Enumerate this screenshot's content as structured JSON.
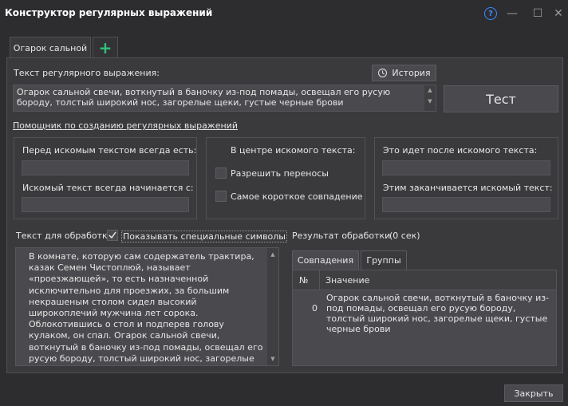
{
  "window": {
    "title": "Конструктор регулярных выражений",
    "help_glyph": "?",
    "min_glyph": "—",
    "max_glyph": "☐",
    "close_glyph": "✕"
  },
  "tabs": {
    "active_label": "Огарок сальной",
    "add_glyph": "+"
  },
  "regex": {
    "label": "Текст регулярного выражения:",
    "history_button": "История",
    "value": "Огарок сальной свечи, воткнутый в баночку из-под помады, освещал его русую бороду, толстый широкий нос, загорелые щеки, густые черные брови",
    "test_button": "Тест"
  },
  "helper": {
    "link": "Помощник по созданию регулярных выражений",
    "left": {
      "before_label": "Перед искомым текстом всегда есть:",
      "begins_label": "Искомый текст всегда начинается с:"
    },
    "center": {
      "title": "В центре искомого текста:",
      "allow_wrap": "Разрешить переносы",
      "shortest_match": "Самое короткое совпадение"
    },
    "right": {
      "after_label": "Это идет после искомого текста:",
      "ends_label": "Этим заканчивается искомый текст:"
    }
  },
  "source": {
    "label": "Текст для обработки",
    "show_special": "Показывать специальные символы",
    "show_special_checked": true,
    "text": "В комнате, которую сам содержатель трактира, казак Семен Чистоплюй, называет «проезжающей», то есть назначенной исключительно для проезжих, за большим некрашеным столом сидел высокий широкоплечий мужчина лет сорока. Облокотившись о стол и подперев голову кулаком, он спал. Огарок сальной свечи, воткнутый в баночку из-под помады, освещал его русую бороду, толстый широкий нос, загорелые щеки, густые черные брови, нависшие над закрытыми глазами... И нос, и щеки, и брови, все черты, каждая в"
  },
  "result": {
    "label": "Результат обработки",
    "time": "(0 сек)",
    "tabs": [
      "Совпадения",
      "Группы"
    ],
    "columns": [
      "№",
      "Значение"
    ],
    "rows": [
      {
        "num": "0",
        "value": "Огарок сальной свечи, воткнутый в баночку из-под помады, освещал его русую бороду, толстый широкий нос, загорелые щеки, густые черные брови"
      }
    ]
  },
  "footer": {
    "close_button": "Закрыть"
  },
  "colors": {
    "background": "#2d2d30",
    "panel": "#3a3a3d",
    "field": "#4a4a4e",
    "accent_help": "#3b8bff",
    "accent_add": "#2ec37a"
  }
}
